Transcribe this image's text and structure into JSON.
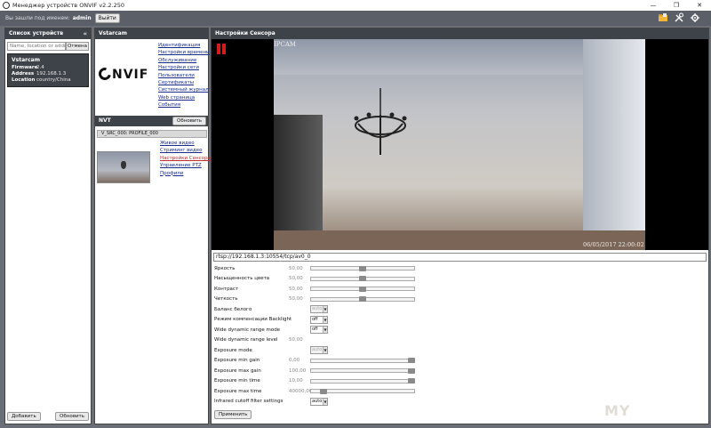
{
  "window": {
    "title": "Менеджер устройств ONVIF v2.2.250",
    "minimize": "—",
    "restore": "❐",
    "close": "✕"
  },
  "topbar": {
    "login_text": "Вы зашли под именем:",
    "user": "admin",
    "exit_button": "Выйти"
  },
  "device_list": {
    "header": "Список устройств",
    "collapse": "«",
    "search_placeholder": "Name, location or address",
    "clear_button": "Отмена",
    "devices": [
      {
        "name": "Vstarcam",
        "firmware_label": "Firmware",
        "firmware": "2.4",
        "address_label": "Address",
        "address": "192.168.1.3",
        "location_label": "Location",
        "location": "country/China"
      }
    ],
    "add_button": "Добавить",
    "refresh_button": "Обновить"
  },
  "device_panel": {
    "header": "Vstarcam",
    "logo_text": "NVIF",
    "links": [
      "Идентификация",
      "Настройки времени",
      "Обслуживание",
      "Настройки сети",
      "Пользователи",
      "Сертификаты",
      "Системный журнал",
      "Web страница",
      "События"
    ],
    "nvt_header": "NVT",
    "nvt_refresh": "Обновить",
    "profile": "V_SRC_000: PROFILE_000",
    "profile_links": [
      "Живое видео",
      "Стриминг видео",
      "Настройки Сенсора",
      "Управление PTZ",
      "Профили"
    ],
    "active_profile_link": 2
  },
  "sensor": {
    "header": "Настройки Сенсора",
    "osd_name": "IPCAM",
    "osd_time": "06/05/2017  22:00:02",
    "stream_url": "rtsp://192.168.1.3:10554/tcp/av0_0",
    "sliders": [
      {
        "label": "Яркость",
        "value": "50,00",
        "level": 0.5
      },
      {
        "label": "Насыщенность цвета",
        "value": "50,00",
        "level": 0.5
      },
      {
        "label": "Контраст",
        "value": "50,00",
        "level": 0.5
      },
      {
        "label": "Четкость",
        "value": "50,00",
        "level": 0.5
      }
    ],
    "white_balance": {
      "label": "Баланс белого",
      "value": "auto"
    },
    "backlight": {
      "label": "Режим компенсации Backlight",
      "value": "off"
    },
    "wdr_mode": {
      "label": "Wide dynamic range mode",
      "value": "off"
    },
    "wdr_level": {
      "label": "Wide dynamic range level",
      "value": "50,00"
    },
    "exposure_mode": {
      "label": "Exposure mode",
      "value": "auto"
    },
    "exposure_sliders": [
      {
        "label": "Exposure min gain",
        "value": "0,00",
        "level": 0.97
      },
      {
        "label": "Exposure max gain",
        "value": "100,00",
        "level": 0.97
      },
      {
        "label": "Exposure min time",
        "value": "10,00",
        "level": 0.97
      },
      {
        "label": "Exposure max time",
        "value": "40000,00",
        "level": 0.12
      }
    ],
    "ir_filter": {
      "label": "Infrared cutoff filter settings",
      "value": "auto"
    },
    "apply_button": "Применить"
  },
  "watermark": "MY"
}
